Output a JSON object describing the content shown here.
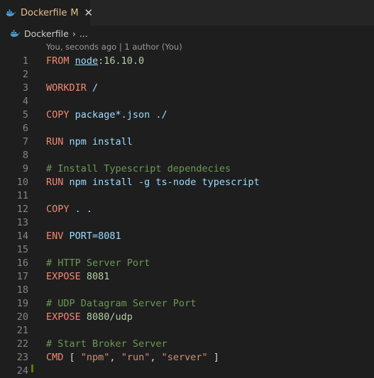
{
  "tab": {
    "filename": "Dockerfile",
    "badge": "M",
    "close": "✕",
    "icon": "docker-whale-icon"
  },
  "breadcrumb": {
    "file": "Dockerfile",
    "separator": "›",
    "more": "..."
  },
  "codelens": "You, seconds ago | 1 author (You)",
  "colors": {
    "keyword": "#f48771",
    "comment": "#6a9955",
    "string": "#ce9178",
    "number": "#b5cea8",
    "tab_modified": "#e2c08d"
  },
  "lines": [
    {
      "n": "1",
      "parts": [
        {
          "t": "FROM ",
          "c": "kw"
        },
        {
          "t": "node",
          "c": "link"
        },
        {
          "t": ":16.10.0",
          "c": "num"
        }
      ]
    },
    {
      "n": "2",
      "parts": []
    },
    {
      "n": "3",
      "parts": [
        {
          "t": "WORKDIR ",
          "c": "kw"
        },
        {
          "t": "/",
          "c": "txt"
        }
      ]
    },
    {
      "n": "4",
      "parts": []
    },
    {
      "n": "5",
      "parts": [
        {
          "t": "COPY ",
          "c": "kw"
        },
        {
          "t": "package*.json ./",
          "c": "txt"
        }
      ]
    },
    {
      "n": "6",
      "parts": []
    },
    {
      "n": "7",
      "parts": [
        {
          "t": "RUN ",
          "c": "kw"
        },
        {
          "t": "npm install",
          "c": "txt"
        }
      ]
    },
    {
      "n": "8",
      "parts": []
    },
    {
      "n": "9",
      "parts": [
        {
          "t": "# Install Typescript dependecies",
          "c": "cm"
        }
      ]
    },
    {
      "n": "10",
      "parts": [
        {
          "t": "RUN ",
          "c": "kw"
        },
        {
          "t": "npm install -g ts-node typescript",
          "c": "txt"
        }
      ]
    },
    {
      "n": "11",
      "parts": []
    },
    {
      "n": "12",
      "parts": [
        {
          "t": "COPY ",
          "c": "kw"
        },
        {
          "t": ". .",
          "c": "txt"
        }
      ]
    },
    {
      "n": "13",
      "parts": []
    },
    {
      "n": "14",
      "parts": [
        {
          "t": "ENV ",
          "c": "kw"
        },
        {
          "t": "PORT=8081",
          "c": "txt"
        }
      ]
    },
    {
      "n": "15",
      "parts": []
    },
    {
      "n": "16",
      "parts": [
        {
          "t": "# HTTP Server Port",
          "c": "cm"
        }
      ]
    },
    {
      "n": "17",
      "parts": [
        {
          "t": "EXPOSE ",
          "c": "kw"
        },
        {
          "t": "8081",
          "c": "num"
        }
      ]
    },
    {
      "n": "18",
      "parts": []
    },
    {
      "n": "19",
      "parts": [
        {
          "t": "# UDP Datagram Server Port",
          "c": "cm"
        }
      ]
    },
    {
      "n": "20",
      "parts": [
        {
          "t": "EXPOSE ",
          "c": "kw"
        },
        {
          "t": "8080/udp",
          "c": "num"
        }
      ]
    },
    {
      "n": "21",
      "parts": []
    },
    {
      "n": "22",
      "parts": [
        {
          "t": "# Start Broker Server",
          "c": "cm"
        }
      ]
    },
    {
      "n": "23",
      "parts": [
        {
          "t": "CMD ",
          "c": "kw"
        },
        {
          "t": "[ ",
          "c": "plain"
        },
        {
          "t": "\"npm\"",
          "c": "str"
        },
        {
          "t": ", ",
          "c": "plain"
        },
        {
          "t": "\"run\"",
          "c": "str"
        },
        {
          "t": ", ",
          "c": "plain"
        },
        {
          "t": "\"server\"",
          "c": "str"
        },
        {
          "t": " ]",
          "c": "plain"
        }
      ]
    },
    {
      "n": "24",
      "parts": []
    }
  ]
}
